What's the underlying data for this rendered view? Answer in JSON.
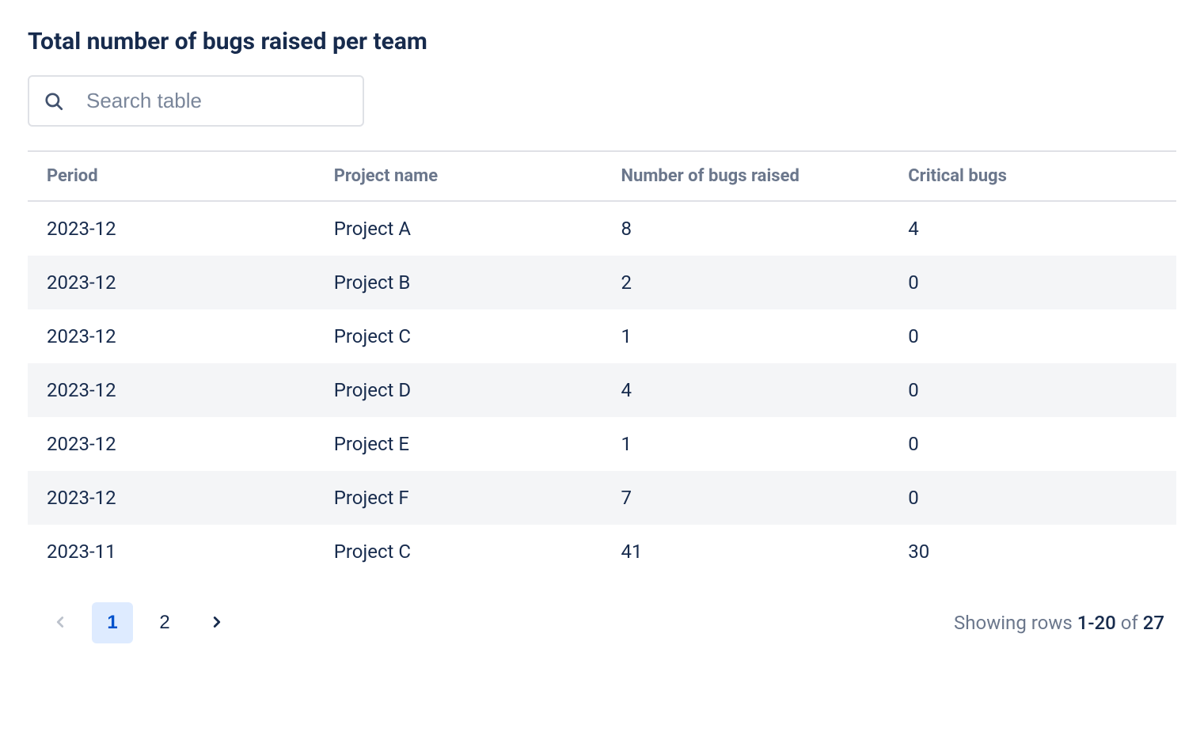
{
  "title": "Total number of bugs raised per team",
  "search": {
    "placeholder": "Search table"
  },
  "table": {
    "columns": {
      "period": "Period",
      "project": "Project name",
      "bugs": "Number of bugs raised",
      "critical": "Critical bugs"
    },
    "rows": [
      {
        "period": "2023-12",
        "project": "Project A",
        "bugs": "8",
        "critical": "4"
      },
      {
        "period": "2023-12",
        "project": "Project B",
        "bugs": "2",
        "critical": "0"
      },
      {
        "period": "2023-12",
        "project": "Project C",
        "bugs": "1",
        "critical": "0"
      },
      {
        "period": "2023-12",
        "project": "Project D",
        "bugs": "4",
        "critical": "0"
      },
      {
        "period": "2023-12",
        "project": "Project E",
        "bugs": "1",
        "critical": "0"
      },
      {
        "period": "2023-12",
        "project": "Project F",
        "bugs": "7",
        "critical": "0"
      },
      {
        "period": "2023-11",
        "project": "Project C",
        "bugs": "41",
        "critical": "30"
      }
    ]
  },
  "pagination": {
    "pages": [
      "1",
      "2"
    ],
    "activePage": "1",
    "info_prefix": "Showing rows ",
    "info_range": "1-20",
    "info_of": " of ",
    "info_total": "27"
  }
}
